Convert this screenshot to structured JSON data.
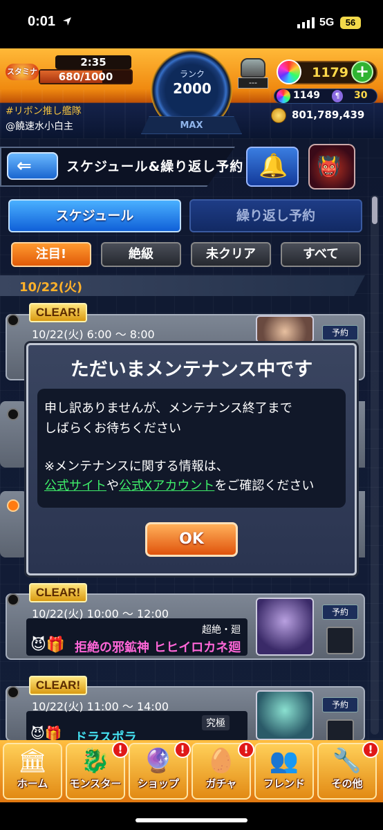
{
  "status_bar": {
    "time": "0:01",
    "network": "5G",
    "battery": "56"
  },
  "hud": {
    "stamina_label": "スタミナ",
    "stamina_timer": "2:35",
    "stamina_value": "680/1000",
    "stamina_fraction": 0.68,
    "rank_label": "ランク",
    "rank_value": "2000",
    "rank_max": "MAX",
    "helmet_value": "---",
    "orbs": "1179",
    "orb_plus": "+",
    "sub_orbs": "1149",
    "sub_tickets": "30",
    "gold": "801,789,439",
    "player_tag": "#リボン推し艦隊",
    "player_name": "@饒速水小白主"
  },
  "header": {
    "back": "⇐",
    "title": "スケジュール&繰り返し予約"
  },
  "tabs": {
    "schedule": "スケジュール",
    "repeat": "繰り返し予約"
  },
  "filters": {
    "featured": "注目!",
    "extreme": "絶級",
    "uncleared": "未クリア",
    "all": "すべて"
  },
  "date_header": "10/22(火)",
  "cards": [
    {
      "badge": "CLEAR!",
      "time": "10/22(火) 6:00 〜 8:00",
      "reserve": "予約"
    },
    {
      "badge": "CLEAR!",
      "time": "10/22(火) 10:00 〜 12:00",
      "difficulty": "超絶・廻",
      "quest": "拒絶の邪鉱神 ヒヒイロカネ廻",
      "reserve": "予約"
    },
    {
      "badge": "CLEAR!",
      "time": "10/22(火) 11:00 〜 14:00",
      "difficulty": "究極",
      "quest": "ドラスポラ",
      "reserve": "予約"
    }
  ],
  "modal": {
    "title": "ただいまメンテナンス中です",
    "line1": "申し訳ありませんが、メンテナンス終了まで",
    "line2": "しばらくお待ちください",
    "line3": "※メンテナンスに関する情報は、",
    "link1": "公式サイト",
    "mid": "や",
    "link2": "公式Xアカウント",
    "tail": "をご確認ください",
    "ok": "OK"
  },
  "nav": [
    {
      "label": "ホーム",
      "icon": "home-icon"
    },
    {
      "label": "モンスター",
      "icon": "monster-icon",
      "alert": "!"
    },
    {
      "label": "ショップ",
      "icon": "orb-icon",
      "alert": "!"
    },
    {
      "label": "ガチャ",
      "icon": "egg-icon",
      "alert": "!"
    },
    {
      "label": "フレンド",
      "icon": "friend-icon"
    },
    {
      "label": "その他",
      "icon": "other-icon",
      "alert": "!"
    }
  ],
  "colors": {
    "accent_orange": "#f08a10",
    "clear_gold": "#ffd94a",
    "link_green": "#3ff06a",
    "quest_pink": "#ff66d8"
  }
}
